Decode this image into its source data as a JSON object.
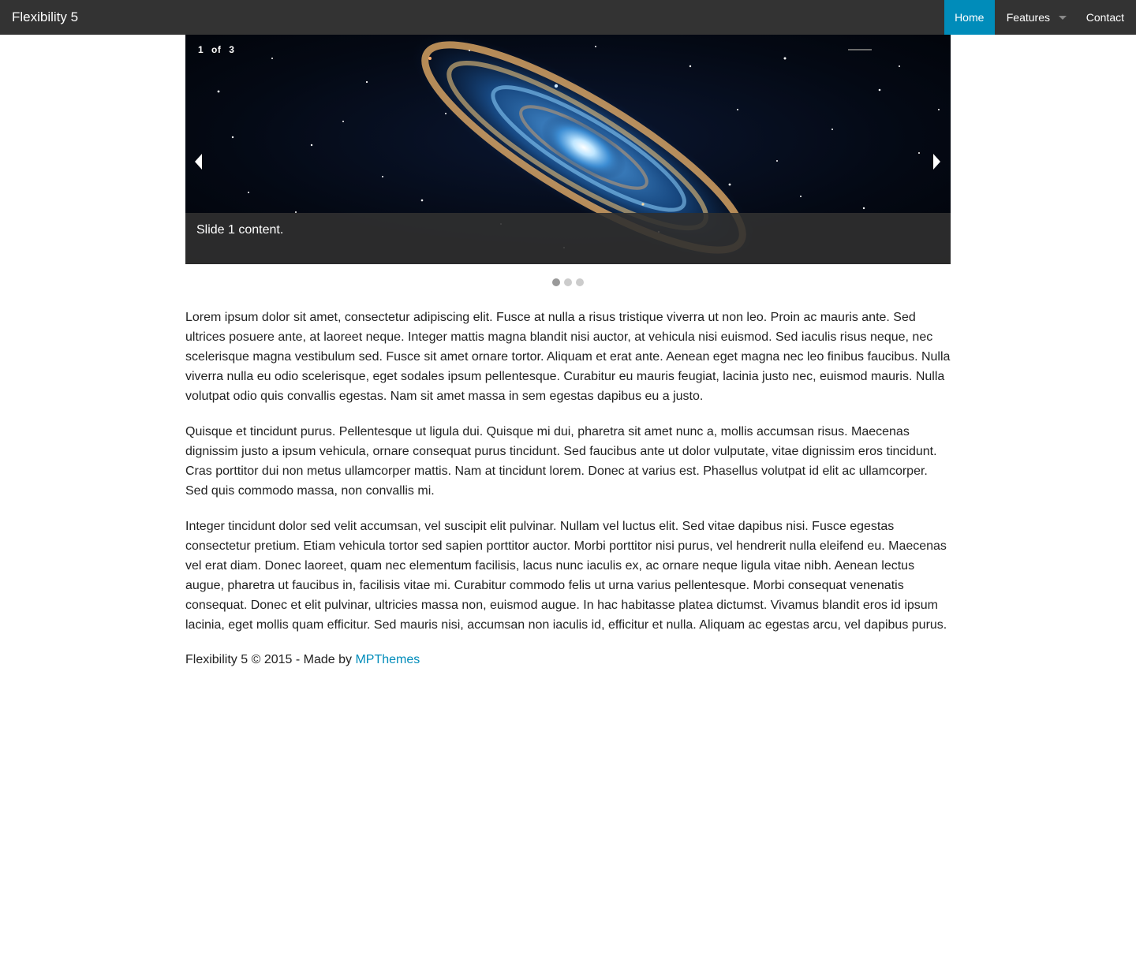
{
  "header": {
    "brand": "Flexibility 5",
    "nav": [
      {
        "label": "Home",
        "active": true
      },
      {
        "label": "Features",
        "has_dropdown": true
      },
      {
        "label": "Contact"
      }
    ]
  },
  "slider": {
    "counter": {
      "current": "1",
      "of": "of",
      "total": "3"
    },
    "caption": "Slide 1 content.",
    "slide_count": 3,
    "active_slide": 1
  },
  "content": {
    "paragraphs": [
      "Lorem ipsum dolor sit amet, consectetur adipiscing elit. Fusce at nulla a risus tristique viverra ut non leo. Proin ac mauris ante. Sed ultrices posuere ante, at laoreet neque. Integer mattis magna blandit nisi auctor, at vehicula nisi euismod. Sed iaculis risus neque, nec scelerisque magna vestibulum sed. Fusce sit amet ornare tortor. Aliquam et erat ante. Aenean eget magna nec leo finibus faucibus. Nulla viverra nulla eu odio scelerisque, eget sodales ipsum pellentesque. Curabitur eu mauris feugiat, lacinia justo nec, euismod mauris. Nulla volutpat odio quis convallis egestas. Nam sit amet massa in sem egestas dapibus eu a justo.",
      "Quisque et tincidunt purus. Pellentesque ut ligula dui. Quisque mi dui, pharetra sit amet nunc a, mollis accumsan risus. Maecenas dignissim justo a ipsum vehicula, ornare consequat purus tincidunt. Sed faucibus ante ut dolor vulputate, vitae dignissim eros tincidunt. Cras porttitor dui non metus ullamcorper mattis. Nam at tincidunt lorem. Donec at varius est. Phasellus volutpat id elit ac ullamcorper. Sed quis commodo massa, non convallis mi.",
      "Integer tincidunt dolor sed velit accumsan, vel suscipit elit pulvinar. Nullam vel luctus elit. Sed vitae dapibus nisi. Fusce egestas consectetur pretium. Etiam vehicula tortor sed sapien porttitor auctor. Morbi porttitor nisi purus, vel hendrerit nulla eleifend eu. Maecenas vel erat diam. Donec laoreet, quam nec elementum facilisis, lacus nunc iaculis ex, ac ornare neque ligula vitae nibh. Aenean lectus augue, pharetra ut faucibus in, facilisis vitae mi. Curabitur commodo felis ut urna varius pellentesque. Morbi consequat venenatis consequat. Donec et elit pulvinar, ultricies massa non, euismod augue. In hac habitasse platea dictumst. Vivamus blandit eros id ipsum lacinia, eget mollis quam efficitur. Sed mauris nisi, accumsan non iaculis id, efficitur et nulla. Aliquam ac egestas arcu, vel dapibus purus."
    ]
  },
  "footer": {
    "text": "Flexibility 5 © 2015 - Made by ",
    "link_label": "MPThemes"
  },
  "colors": {
    "topbar": "#333333",
    "accent": "#008cba",
    "text": "#222222"
  },
  "icons": [
    "caret-down-icon",
    "arrow-left-icon",
    "arrow-right-icon"
  ]
}
